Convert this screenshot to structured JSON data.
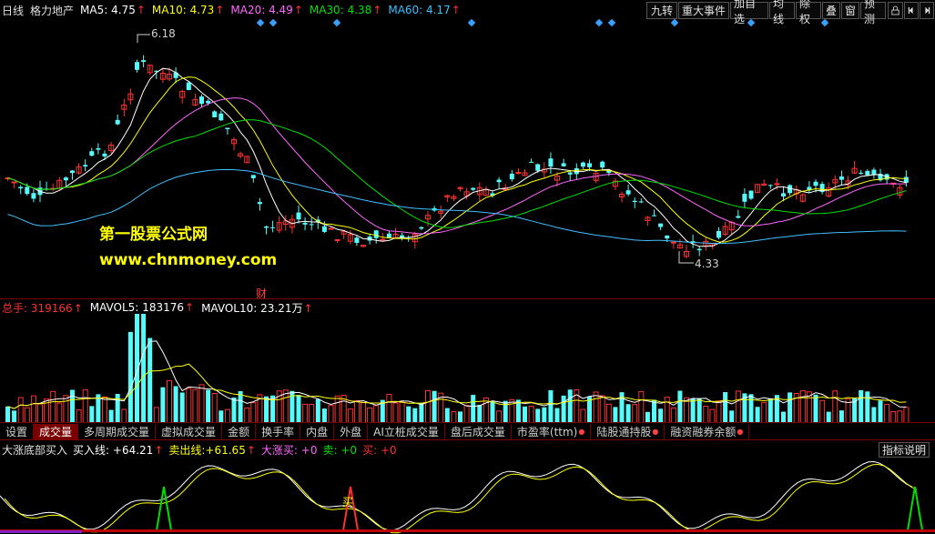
{
  "header": {
    "period": "日线",
    "stock_name": "格力地产",
    "ma5": {
      "label": "MA5:",
      "value": "4.75",
      "color": "#ffffff"
    },
    "ma10": {
      "label": "MA10:",
      "value": "4.73",
      "color": "#ffff00"
    },
    "ma20": {
      "label": "MA20:",
      "value": "4.49",
      "color": "#ff66ff"
    },
    "ma30": {
      "label": "MA30:",
      "value": "4.38",
      "color": "#00e000"
    },
    "ma60": {
      "label": "MA60:",
      "value": "4.17",
      "color": "#40c0ff"
    },
    "up_arrow": "↑"
  },
  "toolbar": {
    "jiuzhuan": "九转",
    "events": "重大事件",
    "add_watch": "加自选",
    "ma_line": "均线",
    "fuquan": "除权",
    "overlay": "叠",
    "window": "窗",
    "forecast": "预测",
    "lock_icon": "lock-icon",
    "prev_icon": "prev-icon",
    "next_icon": "next-icon"
  },
  "price_chart": {
    "high_label": "6.18",
    "low_label": "4.33",
    "cai_marker": "财",
    "watermark_title": "第一股票公式网",
    "watermark_url": "www.chnmoney.com"
  },
  "volume_header": {
    "total": {
      "label": "总手:",
      "value": "319166",
      "color": "#ff3030"
    },
    "mavol5": {
      "label": "MAVOL5:",
      "value": "183176",
      "color": "#ffffff"
    },
    "mavol10": {
      "label": "MAVOL10:",
      "value": "23.21万",
      "color": "#ffffff"
    }
  },
  "tabs": [
    {
      "label": "设置",
      "dot": false
    },
    {
      "label": "成交量",
      "dot": false,
      "active": true
    },
    {
      "label": "多周期成交量",
      "dot": false
    },
    {
      "label": "虚拟成交量",
      "dot": false
    },
    {
      "label": "金额",
      "dot": false
    },
    {
      "label": "换手率",
      "dot": false
    },
    {
      "label": "内盘",
      "dot": false
    },
    {
      "label": "外盘",
      "dot": false
    },
    {
      "label": "AI立桩成交量",
      "dot": false
    },
    {
      "label": "盘后成交量",
      "dot": false
    },
    {
      "label": "市盈率(ttm)",
      "dot": true
    },
    {
      "label": "陆股通持股",
      "dot": true
    },
    {
      "label": "融资融券余额",
      "dot": true
    }
  ],
  "indicator": {
    "name": "大涨底部买入",
    "buy_line": {
      "label": "买入线:",
      "value": "+64.21",
      "color": "#ffffff"
    },
    "sell_line": {
      "label": "卖出线:",
      "value": "+61.65",
      "color": "#ffff00"
    },
    "big_buy": {
      "label": "大涨买:",
      "value": "+0",
      "color": "#ff66ff"
    },
    "sell": {
      "label": "卖:",
      "value": "+0",
      "color": "#00e000"
    },
    "buy": {
      "label": "买:",
      "value": "+0",
      "color": "#ff3030"
    },
    "help_button": "指标说明",
    "buy_marker": "买"
  }
}
